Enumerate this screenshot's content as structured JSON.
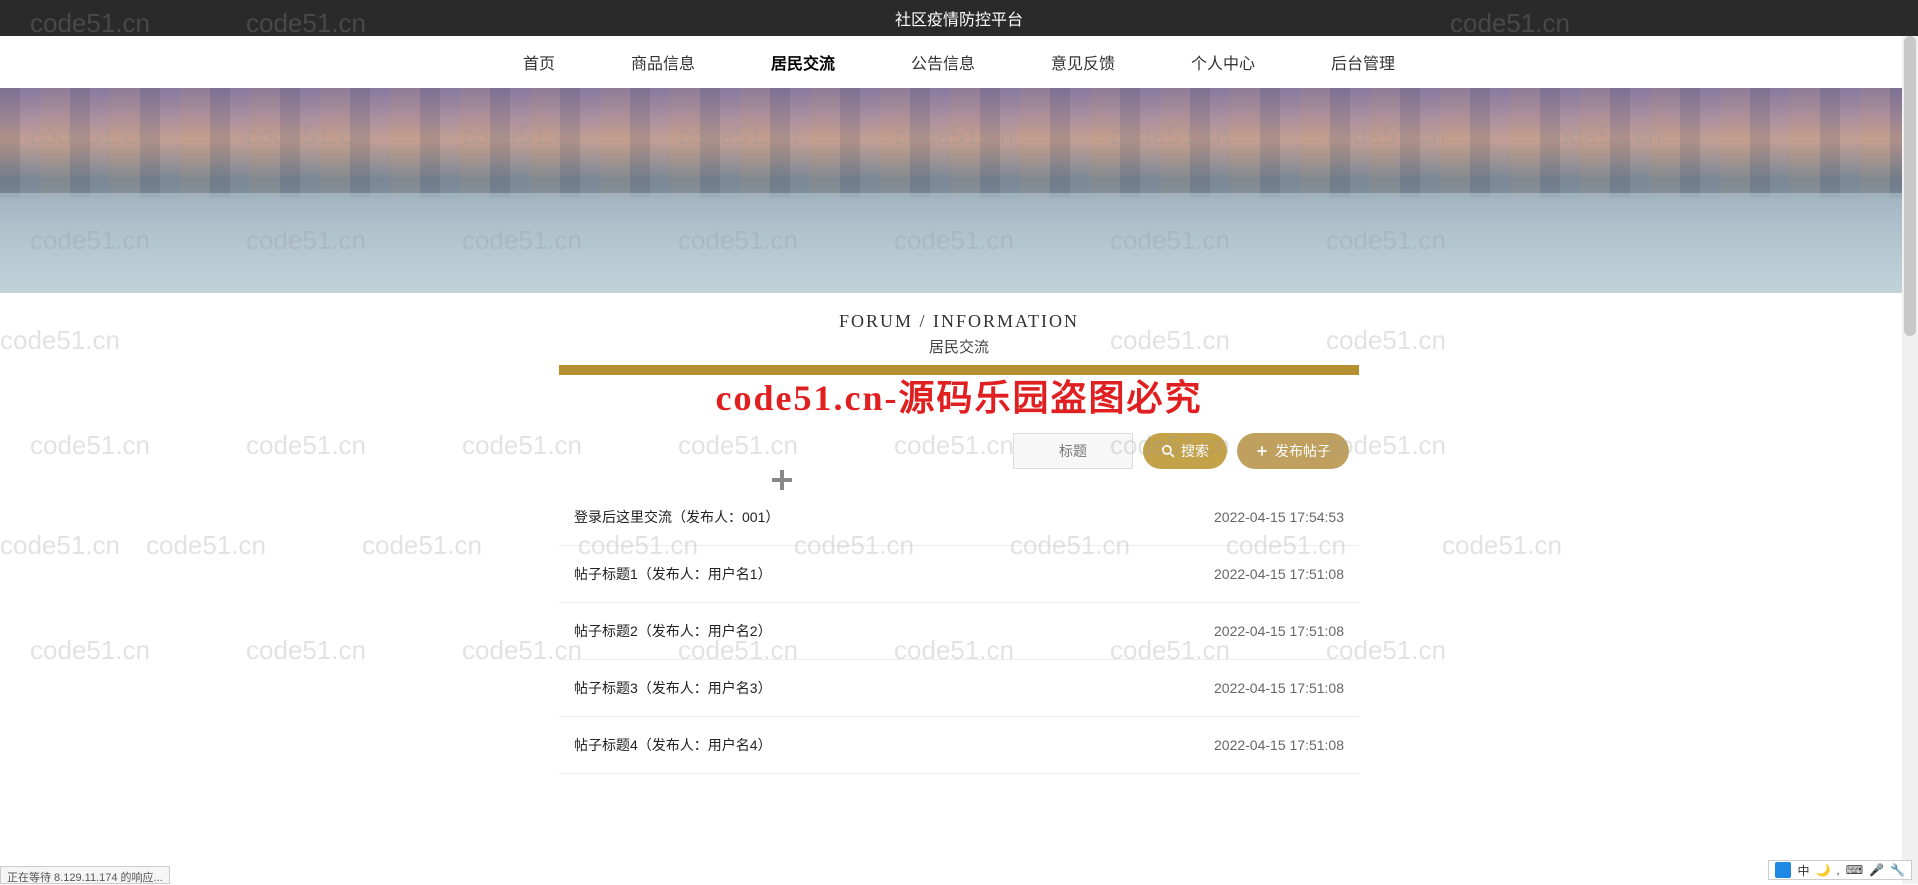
{
  "header": {
    "title": "社区疫情防控平台"
  },
  "nav": {
    "items": [
      {
        "label": "首页"
      },
      {
        "label": "商品信息"
      },
      {
        "label": "居民交流"
      },
      {
        "label": "公告信息"
      },
      {
        "label": "意见反馈"
      },
      {
        "label": "个人中心"
      },
      {
        "label": "后台管理"
      }
    ],
    "active_index": 2
  },
  "section": {
    "title_en": "FORUM / INFORMATION",
    "title_cn": "居民交流"
  },
  "watermark_main": "code51.cn-源码乐园盗图必究",
  "watermark_text": "code51.cn",
  "search": {
    "placeholder": "标题",
    "search_label": "搜索",
    "post_label": "发布帖子"
  },
  "posts": [
    {
      "title": "登录后这里交流（发布人：001）",
      "date": "2022-04-15 17:54:53"
    },
    {
      "title": "帖子标题1（发布人：用户名1）",
      "date": "2022-04-15 17:51:08"
    },
    {
      "title": "帖子标题2（发布人：用户名2）",
      "date": "2022-04-15 17:51:08"
    },
    {
      "title": "帖子标题3（发布人：用户名3）",
      "date": "2022-04-15 17:51:08"
    },
    {
      "title": "帖子标题4（发布人：用户名4）",
      "date": "2022-04-15 17:51:08"
    }
  ],
  "status_bar": "正在等待 8.129.11.174 的响应...",
  "ime": {
    "lang": "中"
  }
}
